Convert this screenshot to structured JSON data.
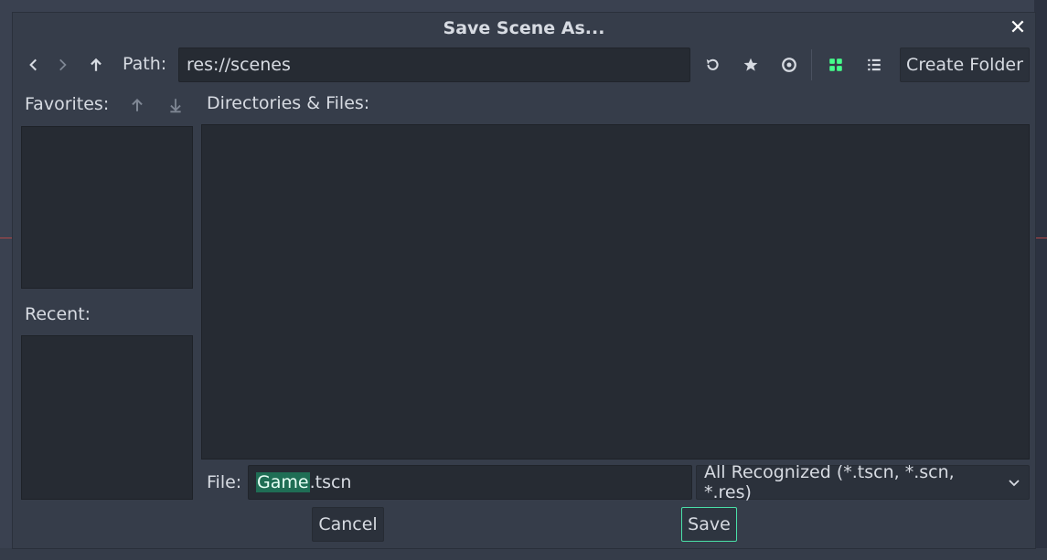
{
  "dialog": {
    "title": "Save Scene As...",
    "close_icon": "close-icon"
  },
  "toolbar": {
    "back_icon": "chevron-left-icon",
    "forward_icon": "chevron-right-icon",
    "up_icon": "arrow-up-icon",
    "path_label": "Path:",
    "path_value": "res://scenes",
    "refresh_icon": "refresh-icon",
    "favorite_icon": "star-icon",
    "hidden_toggle_icon": "eye-icon",
    "grid_view_icon": "grid-view-icon",
    "list_view_icon": "list-view-icon",
    "create_folder_label": "Create Folder",
    "accent_color": "#45ff8b"
  },
  "sidebar": {
    "favorites_label": "Favorites:",
    "move_up_icon": "move-up-icon",
    "move_down_icon": "move-down-icon",
    "recent_label": "Recent:"
  },
  "main": {
    "files_label": "Directories & Files:"
  },
  "footer": {
    "file_label": "File:",
    "file_name_selected": "Game",
    "file_extension": ".tscn",
    "filter_value": "All Recognized (*.tscn, *.scn, *.res)",
    "cancel_label": "Cancel",
    "save_label": "Save"
  }
}
